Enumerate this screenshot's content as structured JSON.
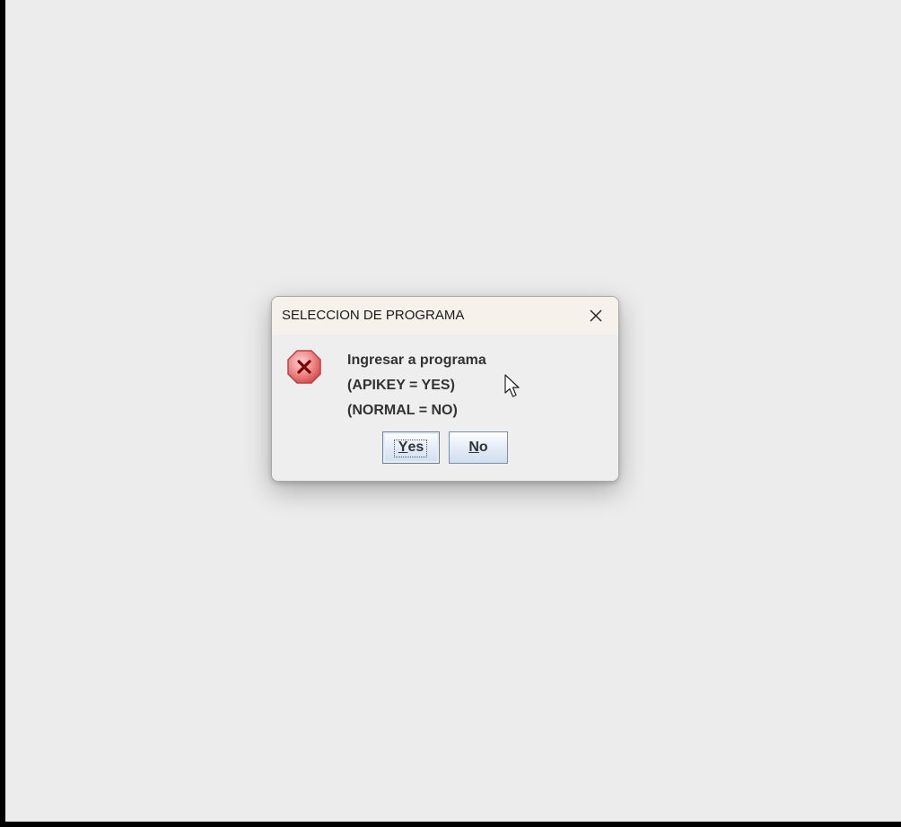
{
  "dialog": {
    "title": "SELECCION DE PROGRAMA",
    "message_lines": [
      "Ingresar a programa",
      "(APIKEY = YES)",
      "(NORMAL = NO)"
    ],
    "icon": "error-icon",
    "buttons": {
      "yes": {
        "mnemonic": "Y",
        "rest": "es"
      },
      "no": {
        "mnemonic": "N",
        "rest": "o"
      }
    },
    "focused_button": "yes"
  },
  "colors": {
    "titlebar": "#f7f1ec",
    "dialog_bg": "#eeeeee",
    "error_red": "#e05a5a",
    "button_border": "#7a8ea6"
  }
}
